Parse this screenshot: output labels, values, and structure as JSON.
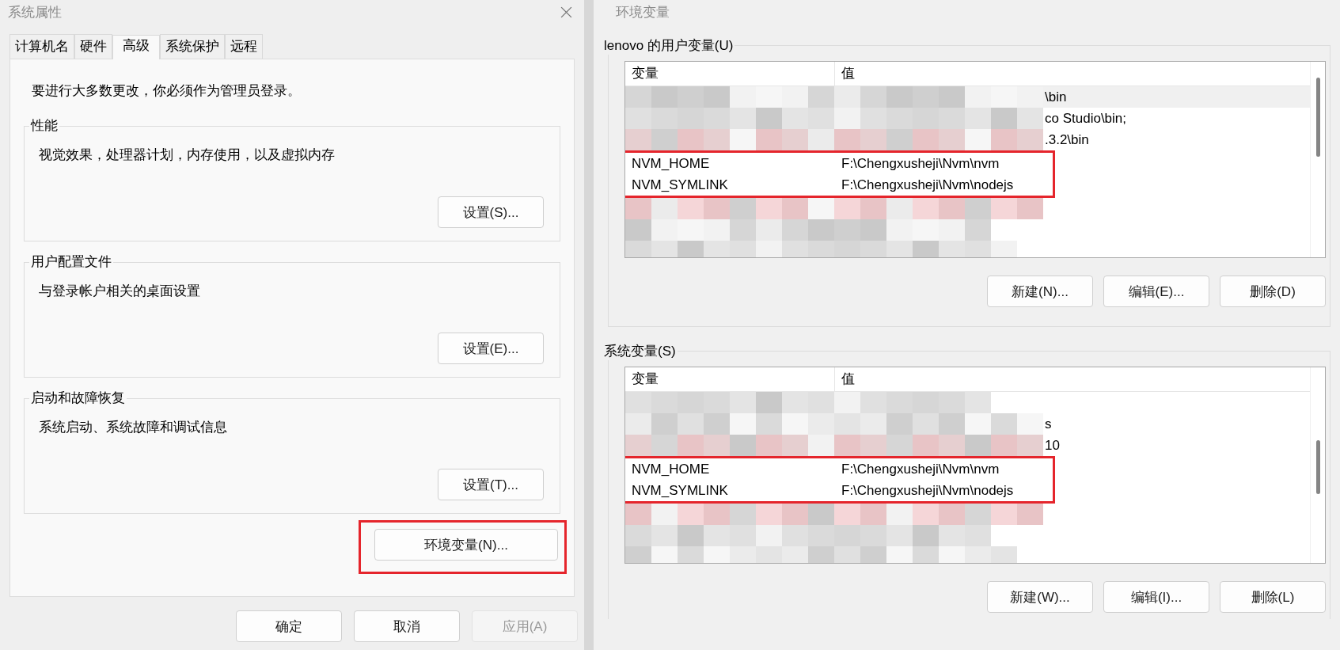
{
  "left_dialog": {
    "title": "系统属性",
    "tabs": [
      {
        "label": "计算机名",
        "selected": false
      },
      {
        "label": "硬件",
        "selected": false
      },
      {
        "label": "高级",
        "selected": true
      },
      {
        "label": "系统保护",
        "selected": false
      },
      {
        "label": "远程",
        "selected": false
      }
    ],
    "note": "要进行大多数更改，你必须作为管理员登录。",
    "groups": [
      {
        "title": "性能",
        "description": "视觉效果，处理器计划，内存使用，以及虚拟内存",
        "button": "设置(S)..."
      },
      {
        "title": "用户配置文件",
        "description": "与登录帐户相关的桌面设置",
        "button": "设置(E)..."
      },
      {
        "title": "启动和故障恢复",
        "description": "系统启动、系统故障和调试信息",
        "button": "设置(T)..."
      }
    ],
    "env_button": {
      "label": "环境变量(N)...",
      "highlighted": true
    },
    "buttons": [
      {
        "label": "确定",
        "disabled": false
      },
      {
        "label": "取消",
        "disabled": false
      },
      {
        "label": "应用(A)",
        "disabled": true
      }
    ]
  },
  "right_dialog": {
    "title": "环境变量",
    "sections": [
      {
        "title": "lenovo 的用户变量(U)",
        "columns": [
          "变量",
          "值"
        ],
        "rows": [
          {
            "kind": "redacted",
            "tail": "\\bin",
            "selected": true,
            "highlighted": false
          },
          {
            "kind": "redacted",
            "tail": "co Studio\\bin;",
            "selected": false,
            "highlighted": false
          },
          {
            "kind": "redacted",
            "tail": ".3.2\\bin",
            "selected": false,
            "highlighted": false
          },
          {
            "kind": "entry",
            "name": "NVM_HOME",
            "value": "F:\\Chengxusheji\\Nvm\\nvm",
            "selected": false,
            "highlighted": true
          },
          {
            "kind": "entry",
            "name": "NVM_SYMLINK",
            "value": "F:\\Chengxusheji\\Nvm\\nodejs",
            "selected": false,
            "highlighted": true
          },
          {
            "kind": "redacted",
            "selected": false,
            "highlighted": false
          },
          {
            "kind": "redacted",
            "selected": false,
            "highlighted": false
          },
          {
            "kind": "redacted",
            "selected": false,
            "highlighted": false
          }
        ],
        "buttons": [
          "新建(N)...",
          "编辑(E)...",
          "删除(D)"
        ]
      },
      {
        "title": "系统变量(S)",
        "columns": [
          "变量",
          "值"
        ],
        "rows": [
          {
            "kind": "redacted",
            "selected": false,
            "highlighted": false
          },
          {
            "kind": "redacted",
            "tail": "s",
            "selected": false,
            "highlighted": false
          },
          {
            "kind": "redacted",
            "tail": "10",
            "selected": false,
            "highlighted": false
          },
          {
            "kind": "entry",
            "name": "NVM_HOME",
            "value": "F:\\Chengxusheji\\Nvm\\nvm",
            "selected": false,
            "highlighted": true
          },
          {
            "kind": "entry",
            "name": "NVM_SYMLINK",
            "value": "F:\\Chengxusheji\\Nvm\\nodejs",
            "selected": false,
            "highlighted": true
          },
          {
            "kind": "redacted",
            "selected": false,
            "highlighted": false
          },
          {
            "kind": "redacted",
            "selected": false,
            "highlighted": false
          },
          {
            "kind": "redacted",
            "selected": false,
            "highlighted": false
          }
        ],
        "buttons": [
          "新建(W)...",
          "编辑(I)...",
          "删除(L)"
        ]
      }
    ]
  }
}
